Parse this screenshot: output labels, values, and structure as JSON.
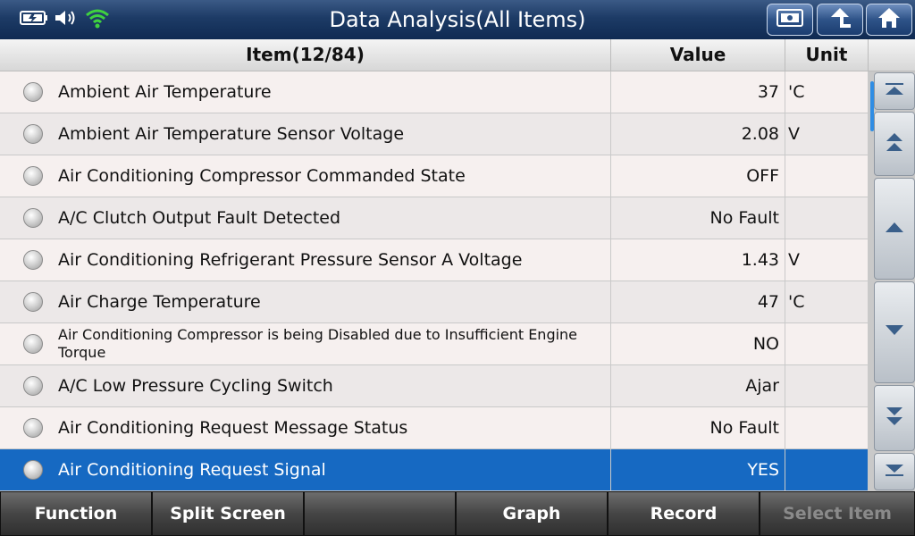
{
  "header": {
    "title": "Data Analysis(All Items)"
  },
  "status_icons": [
    "battery-icon",
    "speaker-icon",
    "wifi-icon"
  ],
  "header_buttons": [
    "screenshot-icon",
    "back-icon",
    "home-icon"
  ],
  "table": {
    "headers": {
      "item": "Item(12/84)",
      "value": "Value",
      "unit": "Unit"
    },
    "rows": [
      {
        "item": "Ambient Air Temperature",
        "value": "37",
        "unit": "'C"
      },
      {
        "item": "Ambient Air Temperature Sensor Voltage",
        "value": "2.08",
        "unit": "V"
      },
      {
        "item": "Air Conditioning Compressor Commanded State",
        "value": "OFF",
        "unit": ""
      },
      {
        "item": "A/C Clutch Output Fault Detected",
        "value": "No Fault",
        "unit": ""
      },
      {
        "item": "Air Conditioning Refrigerant Pressure Sensor A Voltage",
        "value": "1.43",
        "unit": "V"
      },
      {
        "item": "Air Charge Temperature",
        "value": "47",
        "unit": "'C"
      },
      {
        "item": "Air Conditioning Compressor is being Disabled due to Insufficient Engine Torque",
        "value": "NO",
        "unit": ""
      },
      {
        "item": "A/C Low Pressure Cycling Switch",
        "value": "Ajar",
        "unit": ""
      },
      {
        "item": "Air Conditioning Request Message Status",
        "value": "No Fault",
        "unit": ""
      },
      {
        "item": "Air Conditioning Request Signal",
        "value": "YES",
        "unit": ""
      }
    ],
    "selected_row": 9
  },
  "scroll_buttons": [
    "scroll-top-icon",
    "page-up-icon",
    "scroll-up-icon",
    "scroll-down-icon",
    "page-down-icon",
    "scroll-bottom-icon"
  ],
  "bottom_bar": {
    "function": "Function",
    "split_screen": "Split Screen",
    "blank": "",
    "graph": "Graph",
    "record": "Record",
    "select_item": "Select Item"
  },
  "colors": {
    "header": "#1d3b66",
    "selected": "#1669c2",
    "accent_wifi": "#3fd23f"
  }
}
